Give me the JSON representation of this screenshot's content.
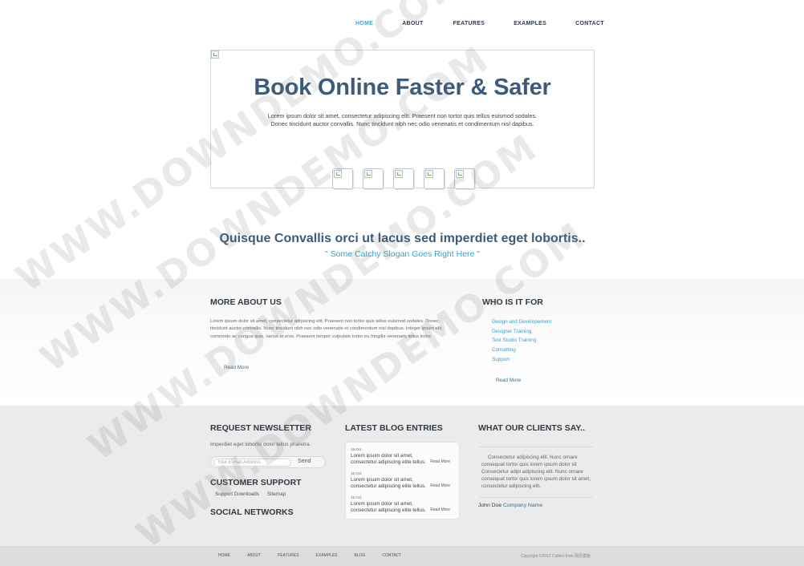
{
  "nav": {
    "items": [
      "HOME",
      "ABOUT",
      "FEATURES",
      "EXAMPLES",
      "CONTACT"
    ],
    "active": "HOME"
  },
  "hero": {
    "title": "Book Online Faster & Safer",
    "text_line1": "Lorem ipsum dolor sit amet, consectetur adipiscing elit. Praesent non tortor quis tellus euismod sodales.",
    "text_line2": "Donec tincidunt auctor convallis. Nunc tincidunt nibh nec odio venenatis et condimentum nisl dapibus."
  },
  "tagline": "Quisque Convallis orci ut lacus sed imperdiet eget lobortis..",
  "slogan": "\" Some Catchy Slogan Goes Right Here \"",
  "about": {
    "heading": "MORE ABOUT US",
    "text": "Lorem ipsum dolor sit amet, consectetur adipiscing elit. Praesent non tortor quis tellus euismod sodales. Donec tincidunt auctor convallis. Nunc tincidunt nibh nec odio venenatis et condimentum nisl dapibus. Integer ipsum elit, commodo ac congue quis, varius at eros. Praesent tempor vulputate tortor eu fringilla venenatis tellus tortor.",
    "read_more": "Read More"
  },
  "who": {
    "heading": "WHO IS IT FOR",
    "items": [
      "Design and Developement",
      "Designer Training",
      "Test Studio Training",
      "Consulting",
      "Support"
    ],
    "read_more": "Read More"
  },
  "newsletter": {
    "heading": "REQUEST NEWSLETTER",
    "text": "Imperdiet eget lobortis dolor tellus pharetra.",
    "placeholder": "Your E-mail Address",
    "button": "Send"
  },
  "support": {
    "heading": "CUSTOMER SUPPORT",
    "links": [
      "Support Downloads",
      "Sitemap"
    ]
  },
  "social": {
    "heading": "SOCIAL NETWORKS"
  },
  "blog": {
    "heading": "LATEST BLOG ENTRIES",
    "entries": [
      {
        "date": "16 Oct",
        "text": "Lorem ipsum dolor sit amet, consectetur adipiscing elite tellus.",
        "more": "Read More"
      },
      {
        "date": "16 Oct",
        "text": "Lorem ipsum dolor sit amet, consectetur adipiscing elite tellus.",
        "more": "Read More"
      },
      {
        "date": "15 Oct",
        "text": "Lorem ipsum dolor sit amet, consectetur adipiscing elite tellus.",
        "more": "Read More"
      }
    ]
  },
  "clients": {
    "heading": "WHAT OUR CLIENTS SAY..",
    "quote": "Consectetur adipiscing elit. Nunc ornare consequat tortor quis lorem ipsum dolor sit Consectetur adipi adipiscing elit. Nunc ornare consequat tortor quis lorem ipsum dolor sit amet, consectetur adipiscing elit.",
    "name": "John Doe",
    "company": "Company Name"
  },
  "footer": {
    "nav": [
      "HOME",
      "ABOUT",
      "FEATURES",
      "EXAMPLES",
      "BLOG",
      "CONTACT"
    ],
    "copyright": "Copyright ©2012 Collect from 网页模板"
  },
  "watermark": "WWW.DOWNDEMO.COM"
}
